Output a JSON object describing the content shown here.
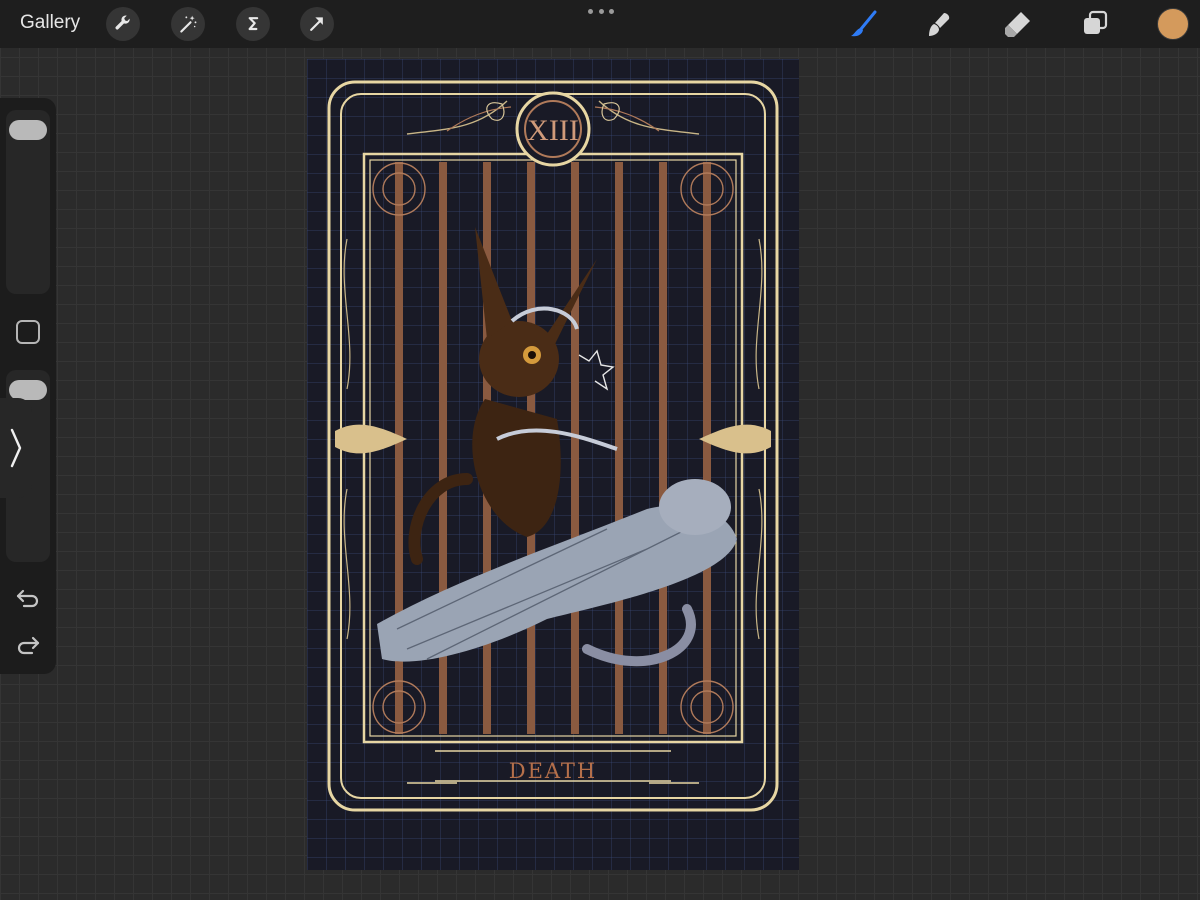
{
  "topbar": {
    "gallery_label": "Gallery",
    "tools": [
      {
        "name": "wrench-icon",
        "label": "Actions"
      },
      {
        "name": "magic-wand-icon",
        "label": "Adjustments"
      },
      {
        "name": "selection-icon",
        "label": "Selection"
      },
      {
        "name": "arrow-icon",
        "label": "Transform"
      }
    ],
    "right_tools": [
      {
        "name": "brush-icon",
        "active": true
      },
      {
        "name": "smudge-icon",
        "active": false
      },
      {
        "name": "eraser-icon",
        "active": false
      },
      {
        "name": "layers-icon",
        "active": false
      }
    ],
    "current_color": "#d49a5c",
    "accent_color": "#2f7cf6"
  },
  "sidebar": {
    "brush_size_level": 0.0,
    "opacity_level": 0.0
  },
  "card": {
    "numeral": "XIII",
    "title": "DEATH",
    "frame_color": "#e7d6a3",
    "bar_color": "#8a5a40",
    "background_color": "#191a26"
  }
}
